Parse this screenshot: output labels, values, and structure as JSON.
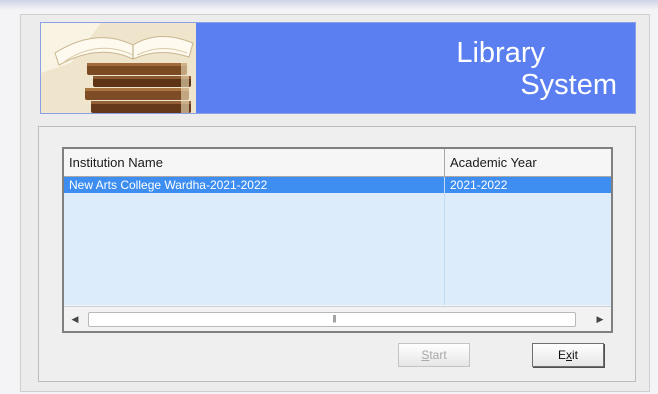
{
  "banner": {
    "title_line1": "Library",
    "title_line2": "System"
  },
  "grid": {
    "columns": [
      "Institution Name",
      "Academic Year"
    ],
    "rows": [
      {
        "institution": "New Arts College Wardha-2021-2022",
        "year": "2021-2022",
        "selected": true
      }
    ],
    "empty_rows": 7
  },
  "buttons": {
    "start_label": "Start",
    "start_mnemonic": "S",
    "start_rest": "tart",
    "exit_label": "Exit",
    "exit_pre": "E",
    "exit_mnemonic": "x",
    "exit_rest": "it"
  },
  "icons": {
    "banner_image": "books-icon",
    "scroll_left": "arrow-left-icon",
    "scroll_right": "arrow-right-icon",
    "scroll_grip": "grip-icon"
  },
  "colors": {
    "banner_bg": "#5b7ff0",
    "selected_row": "#3d8ef0",
    "row_bg": "#dcecfb"
  }
}
